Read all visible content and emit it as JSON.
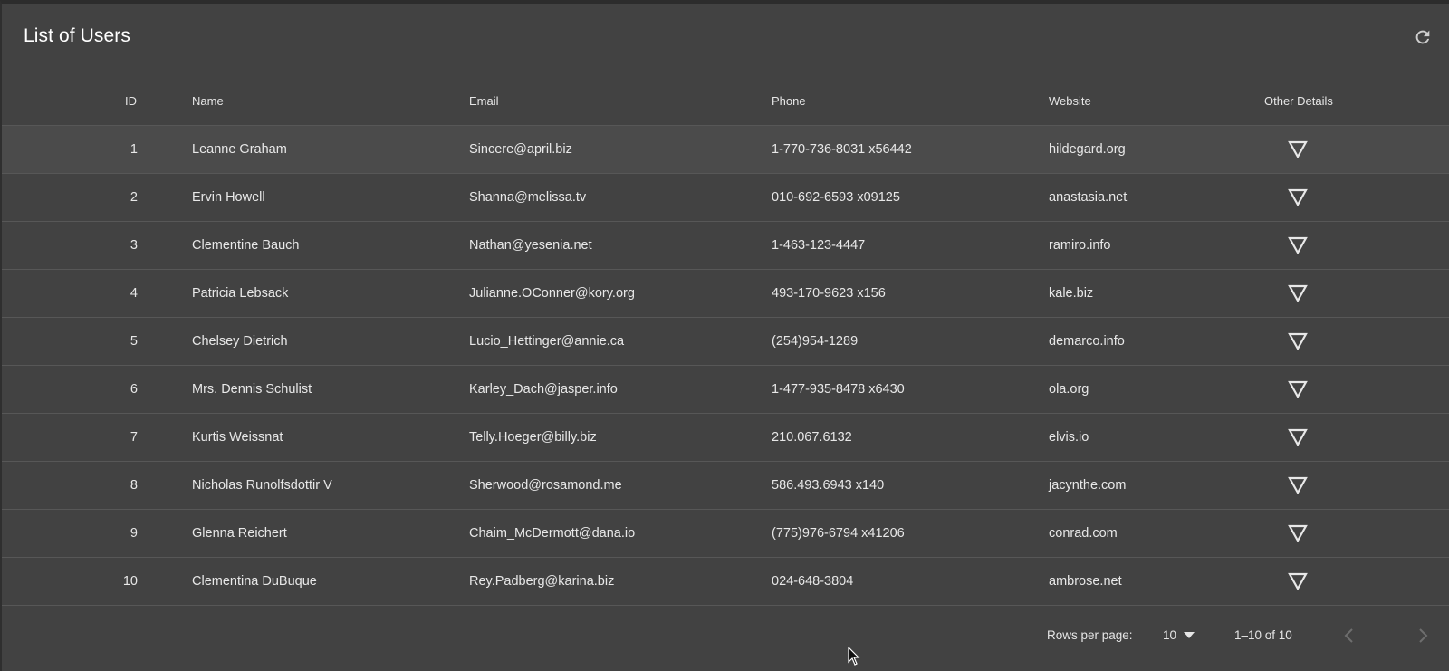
{
  "header": {
    "title": "List of Users",
    "refresh_icon": "refresh-icon"
  },
  "table": {
    "columns": [
      "ID",
      "Name",
      "Email",
      "Phone",
      "Website",
      "Other Details"
    ],
    "rows": [
      {
        "id": "1",
        "name": "Leanne Graham",
        "email": "Sincere@april.biz",
        "phone": "1-770-736-8031 x56442",
        "website": "hildegard.org"
      },
      {
        "id": "2",
        "name": "Ervin Howell",
        "email": "Shanna@melissa.tv",
        "phone": "010-692-6593 x09125",
        "website": "anastasia.net"
      },
      {
        "id": "3",
        "name": "Clementine Bauch",
        "email": "Nathan@yesenia.net",
        "phone": "1-463-123-4447",
        "website": "ramiro.info"
      },
      {
        "id": "4",
        "name": "Patricia Lebsack",
        "email": "Julianne.OConner@kory.org",
        "phone": "493-170-9623 x156",
        "website": "kale.biz"
      },
      {
        "id": "5",
        "name": "Chelsey Dietrich",
        "email": "Lucio_Hettinger@annie.ca",
        "phone": "(254)954-1289",
        "website": "demarco.info"
      },
      {
        "id": "6",
        "name": "Mrs. Dennis Schulist",
        "email": "Karley_Dach@jasper.info",
        "phone": "1-477-935-8478 x6430",
        "website": "ola.org"
      },
      {
        "id": "7",
        "name": "Kurtis Weissnat",
        "email": "Telly.Hoeger@billy.biz",
        "phone": "210.067.6132",
        "website": "elvis.io"
      },
      {
        "id": "8",
        "name": "Nicholas Runolfsdottir V",
        "email": "Sherwood@rosamond.me",
        "phone": "586.493.6943 x140",
        "website": "jacynthe.com"
      },
      {
        "id": "9",
        "name": "Glenna Reichert",
        "email": "Chaim_McDermott@dana.io",
        "phone": "(775)976-6794 x41206",
        "website": "conrad.com"
      },
      {
        "id": "10",
        "name": "Clementina DuBuque",
        "email": "Rey.Padberg@karina.biz",
        "phone": "024-648-3804",
        "website": "ambrose.net"
      }
    ],
    "expand_icon": "triangle-down-icon",
    "hovered_row": "1"
  },
  "pagination": {
    "rows_per_page_label": "Rows per page:",
    "rows_per_page_value": "10",
    "range": "1–10 of 10",
    "prev_icon": "chevron-left-icon",
    "next_icon": "chevron-right-icon"
  },
  "colors": {
    "background": "#424242",
    "row_hover": "#4b4b4b",
    "divider": "#575757",
    "text": "#e8e8e8",
    "disabled": "#6e6e6e"
  }
}
